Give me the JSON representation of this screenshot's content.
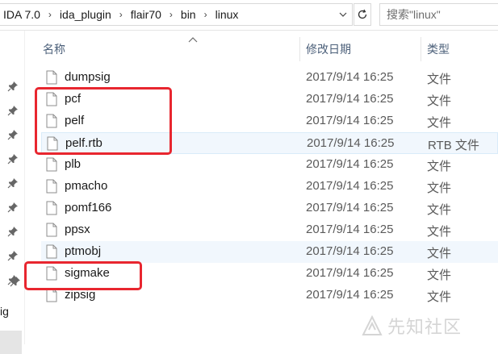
{
  "address": {
    "crumbs": [
      "IDA 7.0",
      "ida_plugin",
      "flair70",
      "bin",
      "linux"
    ],
    "separator": "›",
    "dropdown_icon": "chevron-down-icon",
    "refresh_icon": "refresh-icon"
  },
  "search": {
    "placeholder": "搜索\"linux\"",
    "icon": "search-icon"
  },
  "nav": {
    "partial_text": "ig",
    "pin_icon": "pin-icon"
  },
  "columns": {
    "name": "名称",
    "date": "修改日期",
    "type": "类型"
  },
  "files": [
    {
      "name": "dumpsig",
      "date": "2017/9/14 16:25",
      "type": "文件"
    },
    {
      "name": "pcf",
      "date": "2017/9/14 16:25",
      "type": "文件"
    },
    {
      "name": "pelf",
      "date": "2017/9/14 16:25",
      "type": "文件"
    },
    {
      "name": "pelf.rtb",
      "date": "2017/9/14 16:25",
      "type": "RTB 文件"
    },
    {
      "name": "plb",
      "date": "2017/9/14 16:25",
      "type": "文件"
    },
    {
      "name": "pmacho",
      "date": "2017/9/14 16:25",
      "type": "文件"
    },
    {
      "name": "pomf166",
      "date": "2017/9/14 16:25",
      "type": "文件"
    },
    {
      "name": "ppsx",
      "date": "2017/9/14 16:25",
      "type": "文件"
    },
    {
      "name": "ptmobj",
      "date": "2017/9/14 16:25",
      "type": "文件"
    },
    {
      "name": "sigmake",
      "date": "2017/9/14 16:25",
      "type": "文件"
    },
    {
      "name": "zipsig",
      "date": "2017/9/14 16:25",
      "type": "文件"
    }
  ],
  "selected_file": "pelf.rtb",
  "hovered_file": "ptmobj",
  "highlighted_files": [
    "pcf",
    "pelf",
    "pelf.rtb",
    "sigmake"
  ],
  "watermark": "先知社区",
  "colors": {
    "annotation": "#e8262f",
    "selection": "#f1f7fd",
    "header_text": "#4c607a"
  }
}
